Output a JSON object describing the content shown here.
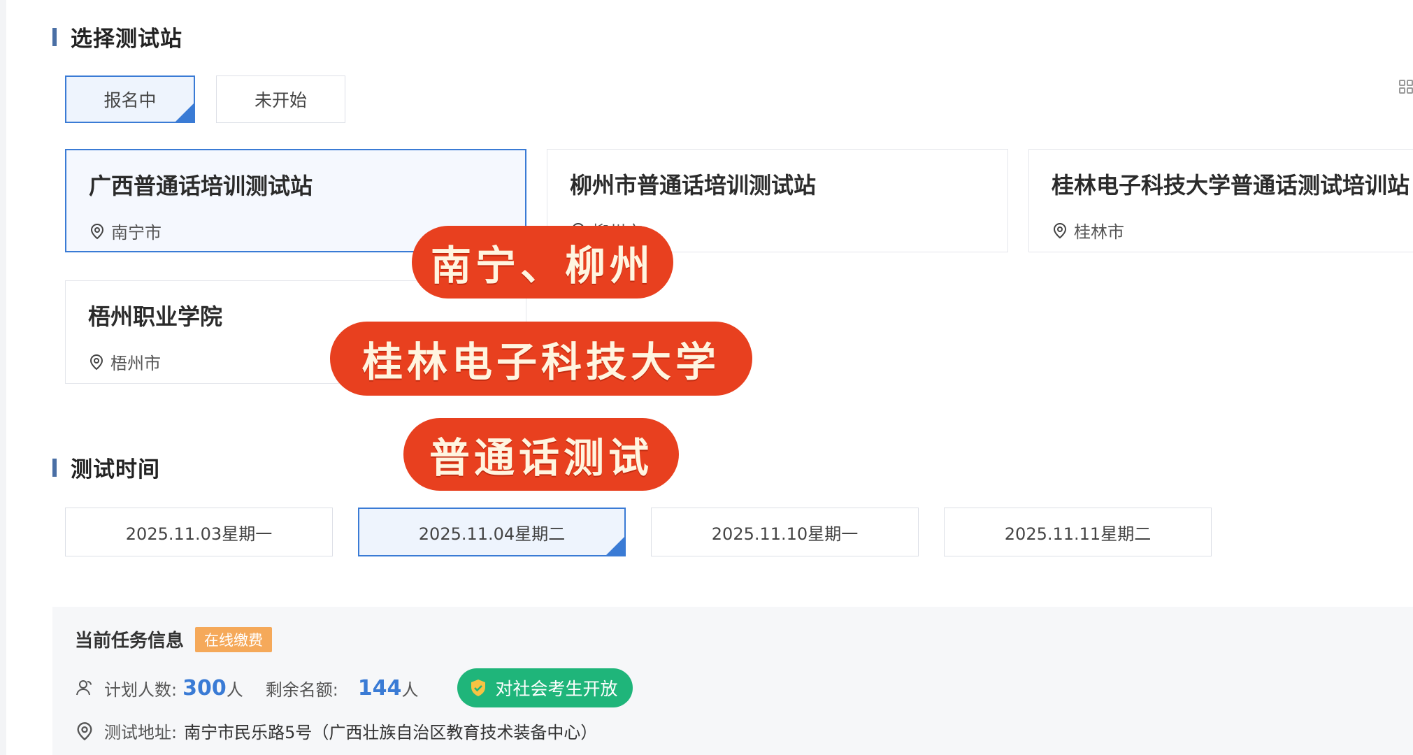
{
  "section_station": {
    "title": "选择测试站"
  },
  "status_tabs": [
    {
      "label": "报名中",
      "active": true
    },
    {
      "label": "未开始",
      "active": false
    }
  ],
  "sites": [
    {
      "name": "广西普通话培训测试站",
      "city": "南宁市",
      "active": true
    },
    {
      "name": "柳州市普通话培训测试站",
      "city": "柳州市",
      "active": false
    },
    {
      "name": "桂林电子科技大学普通话测试培训站",
      "city": "桂林市",
      "active": false
    },
    {
      "name": "梧州职业学院",
      "city": "梧州市",
      "active": false
    }
  ],
  "section_time": {
    "title": "测试时间"
  },
  "dates": [
    {
      "label": "2025.11.03星期一",
      "active": false
    },
    {
      "label": "2025.11.04星期二",
      "active": true
    },
    {
      "label": "2025.11.10星期一",
      "active": false
    },
    {
      "label": "2025.11.11星期二",
      "active": false
    }
  ],
  "task_info": {
    "title": "当前任务信息",
    "badge": "在线缴费",
    "planned_label": "计划人数:",
    "planned_value": "300",
    "planned_unit": "人",
    "remaining_label": "剩余名额:",
    "remaining_value": "144",
    "remaining_unit": "人",
    "open_label": "对社会考生开放",
    "address_label": "测试地址:",
    "address_value": "南宁市民乐路5号（广西壮族自治区教育技术装备中心）"
  },
  "overlay": [
    "南宁、柳州",
    "桂林电子科技大学",
    "普通话测试"
  ],
  "colors": {
    "accent": "#3a7bd5",
    "overlay": "#e8401f",
    "open_pill": "#1fb57a",
    "pay_badge": "#f5a95a"
  },
  "icons": [
    "location-pin-icon",
    "check-icon",
    "grid-view-icon",
    "people-icon",
    "shield-icon"
  ]
}
